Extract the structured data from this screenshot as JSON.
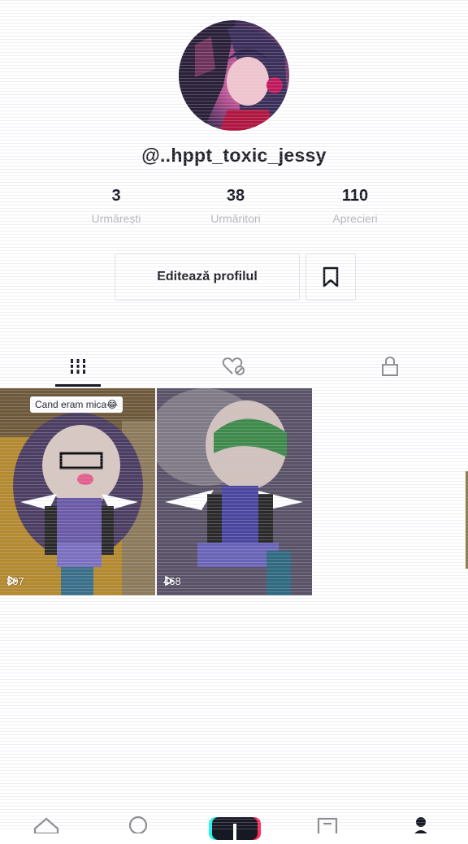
{
  "profile": {
    "username": "@..hppt_toxic_jessy",
    "avatar_icon": "profile-avatar-image"
  },
  "stats": [
    {
      "value": "3",
      "label": "Urmărești"
    },
    {
      "value": "38",
      "label": "Urmăritori"
    },
    {
      "value": "110",
      "label": "Aprecieri"
    }
  ],
  "actions": {
    "edit_profile": "Editează profilul",
    "bookmark_icon": "bookmark-icon"
  },
  "tabs": [
    {
      "icon": "grid-icon",
      "selected": true
    },
    {
      "icon": "liked-hidden-icon",
      "selected": false
    },
    {
      "icon": "lock-icon",
      "selected": false
    }
  ],
  "videos": [
    {
      "caption": "Cand eram mica😂",
      "views": "807"
    },
    {
      "caption": "",
      "views": "468"
    }
  ],
  "bottom_nav": [
    "home-icon",
    "discover-icon",
    "create-plus-icon",
    "inbox-icon",
    "profile-icon"
  ],
  "colors": {
    "text": "#161823",
    "muted": "#b7b7bf",
    "border": "#e3e3e6",
    "accent_cyan": "#25f4ee",
    "accent_red": "#fe2c55"
  }
}
